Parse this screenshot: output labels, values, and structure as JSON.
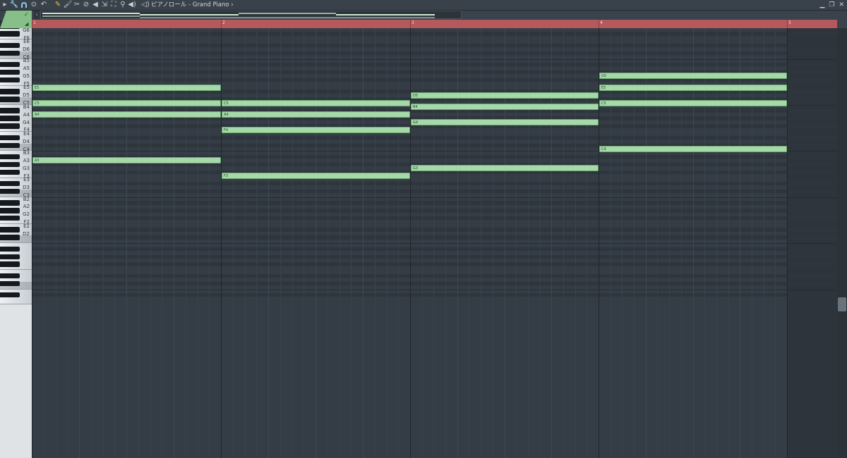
{
  "toolbar": {
    "icons": [
      "menu-arrow-icon",
      "wrench-icon",
      "magnet-icon",
      "target-icon",
      "undo-icon",
      "pencil-icon",
      "paint-brush-icon",
      "scissors-icon",
      "delete-icon",
      "mute-icon",
      "slip-icon",
      "select-icon",
      "zoom-icon",
      "speaker-icon",
      "playback-icon"
    ],
    "title": "ピアノロール - Grand Piano ›"
  },
  "window_buttons": [
    "▁",
    "❐",
    "✕"
  ],
  "ruler": {
    "bars": [
      "1",
      "2",
      "3",
      "4",
      "5"
    ]
  },
  "keyboard": {
    "labels": [
      "G6",
      "F6",
      "E6",
      "D6",
      "C6",
      "B5",
      "A5",
      "G5",
      "F5",
      "E5",
      "D5",
      "C5",
      "B4",
      "A4",
      "G4",
      "F4",
      "E4",
      "D4",
      "C4",
      "B3",
      "A3",
      "G3",
      "F3",
      "E3",
      "D3",
      "C3",
      "B2",
      "A2",
      "G2",
      "F2",
      "E2",
      "D2"
    ]
  },
  "notes": [
    {
      "pitch": "E5",
      "bar": 1,
      "label": "E5"
    },
    {
      "pitch": "C5",
      "bar": 1,
      "label": "C5"
    },
    {
      "pitch": "A4",
      "bar": 1,
      "label": "A4"
    },
    {
      "pitch": "A3",
      "bar": 1,
      "label": "A3"
    },
    {
      "pitch": "C5",
      "bar": 2,
      "label": "C5"
    },
    {
      "pitch": "A4",
      "bar": 2,
      "label": "A4"
    },
    {
      "pitch": "F4",
      "bar": 2,
      "label": "F4"
    },
    {
      "pitch": "F3",
      "bar": 2,
      "label": "F3"
    },
    {
      "pitch": "D5",
      "bar": 3,
      "label": "D5"
    },
    {
      "pitch": "B4",
      "bar": 3,
      "label": "B4"
    },
    {
      "pitch": "G4",
      "bar": 3,
      "label": "G4"
    },
    {
      "pitch": "G3",
      "bar": 3,
      "label": "G3"
    },
    {
      "pitch": "G5",
      "bar": 4,
      "label": "G5"
    },
    {
      "pitch": "E5",
      "bar": 4,
      "label": "E5"
    },
    {
      "pitch": "C5",
      "bar": 4,
      "label": "C5"
    },
    {
      "pitch": "C4",
      "bar": 4,
      "label": "C4"
    }
  ],
  "colors": {
    "note": "#a6d8a9",
    "ruler": "#b6595c",
    "grid": "#343c45"
  }
}
